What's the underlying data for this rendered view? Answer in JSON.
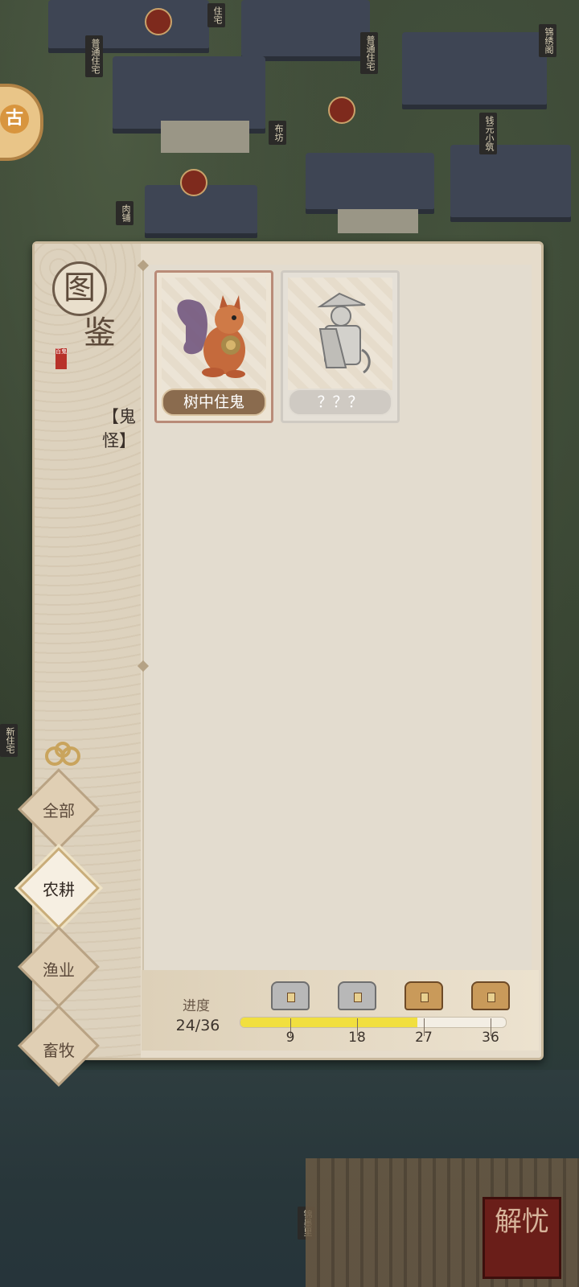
{
  "map": {
    "signs": [
      "住宅",
      "普通住宅",
      "普通住宅",
      "布坊",
      "钱元小筑",
      "肉铺",
      "锦绣阁",
      "锦墨里",
      "新住宅"
    ],
    "seal_text": "解忧"
  },
  "panel": {
    "title_char_1": "图",
    "title_char_2": "鉴",
    "stamp_text": "百鬼",
    "category": "【鬼怪】",
    "cards": [
      {
        "name": "树中住鬼",
        "locked": false,
        "icon": "squirrel-icon"
      },
      {
        "name": "？？？",
        "locked": true,
        "icon": "farmer-silhouette-icon"
      }
    ],
    "tabs": [
      {
        "label": "全部",
        "active": false
      },
      {
        "label": "农耕",
        "active": true
      },
      {
        "label": "渔业",
        "active": false
      },
      {
        "label": "畜牧",
        "active": false
      }
    ],
    "progress": {
      "label": "进度",
      "value_text": "24/36",
      "current": 24,
      "max": 36,
      "milestones": [
        {
          "value": 9,
          "label": "9",
          "claimed": true
        },
        {
          "value": 18,
          "label": "18",
          "claimed": true
        },
        {
          "value": 27,
          "label": "27",
          "claimed": false
        },
        {
          "value": 36,
          "label": "36",
          "claimed": false
        }
      ]
    }
  },
  "colors": {
    "progress_fill": "#f1df3f",
    "card_name_bg": "#8a6b4e",
    "seal_red": "#6a1e19"
  }
}
